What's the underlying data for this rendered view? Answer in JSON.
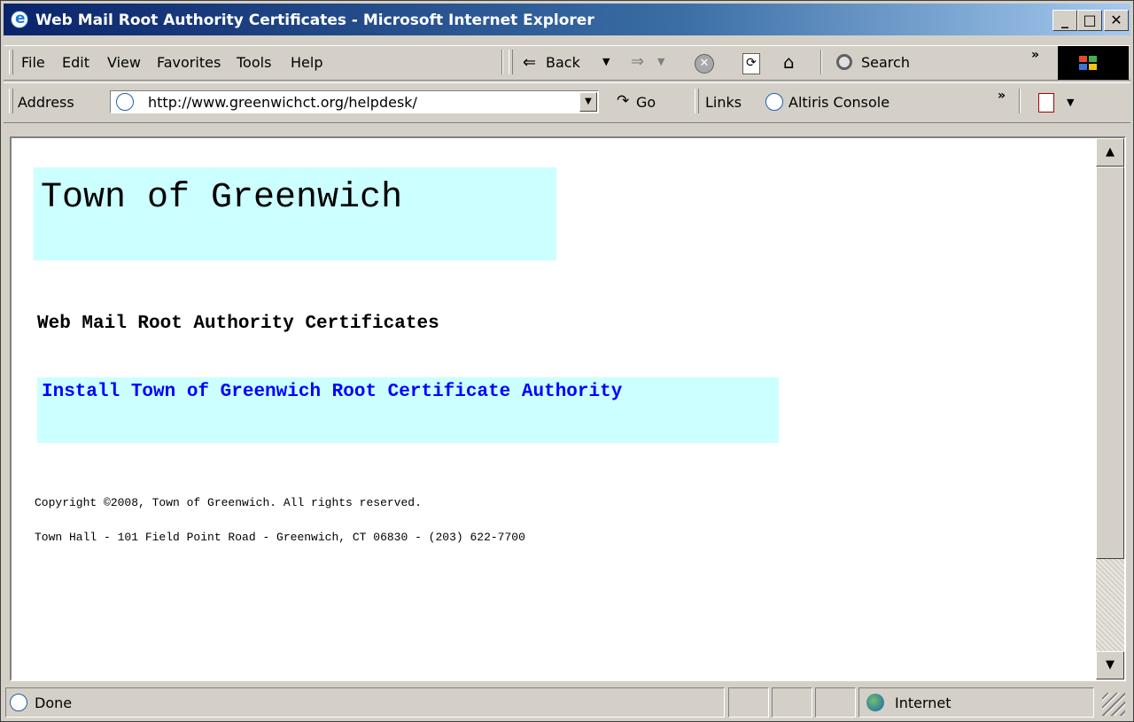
{
  "window": {
    "title": "Web Mail Root Authority Certificates - Microsoft Internet Explorer",
    "minimize": "_",
    "maximize": "□",
    "close": "✕"
  },
  "menu": {
    "items": [
      "File",
      "Edit",
      "View",
      "Favorites",
      "Tools",
      "Help"
    ]
  },
  "toolbar": {
    "back_label": "Back",
    "search_label": "Search",
    "chevron": "»"
  },
  "address_bar": {
    "label": "Address",
    "url": "http://www.greenwichct.org/helpdesk/",
    "go_label": "Go",
    "links_label": "Links",
    "links_item": "Altiris Console",
    "chevron": "»"
  },
  "page": {
    "header_title": "Town of Greenwich",
    "subtitle": "Web Mail Root Authority Certificates",
    "link_text": "Install Town of Greenwich Root Certificate Authority",
    "copyright": "Copyright ©2008, Town of Greenwich. All rights reserved.",
    "address_line": "Town Hall - 101 Field Point Road - Greenwich, CT 06830 - (203) 622-7700"
  },
  "status_bar": {
    "status": "Done",
    "zone": "Internet"
  },
  "colors": {
    "title_bar": "#0a246a",
    "chrome": "#d4d0c8",
    "header_bg": "#ccffff",
    "link": "#0000ff"
  },
  "icons": [
    "ie-page-icon",
    "back-arrow-icon",
    "forward-arrow-icon",
    "stop-icon",
    "refresh-icon",
    "home-icon",
    "search-magnifier-icon",
    "windows-logo-icon",
    "go-arrow-icon",
    "pdf-icon",
    "globe-icon",
    "resize-grip-icon"
  ]
}
